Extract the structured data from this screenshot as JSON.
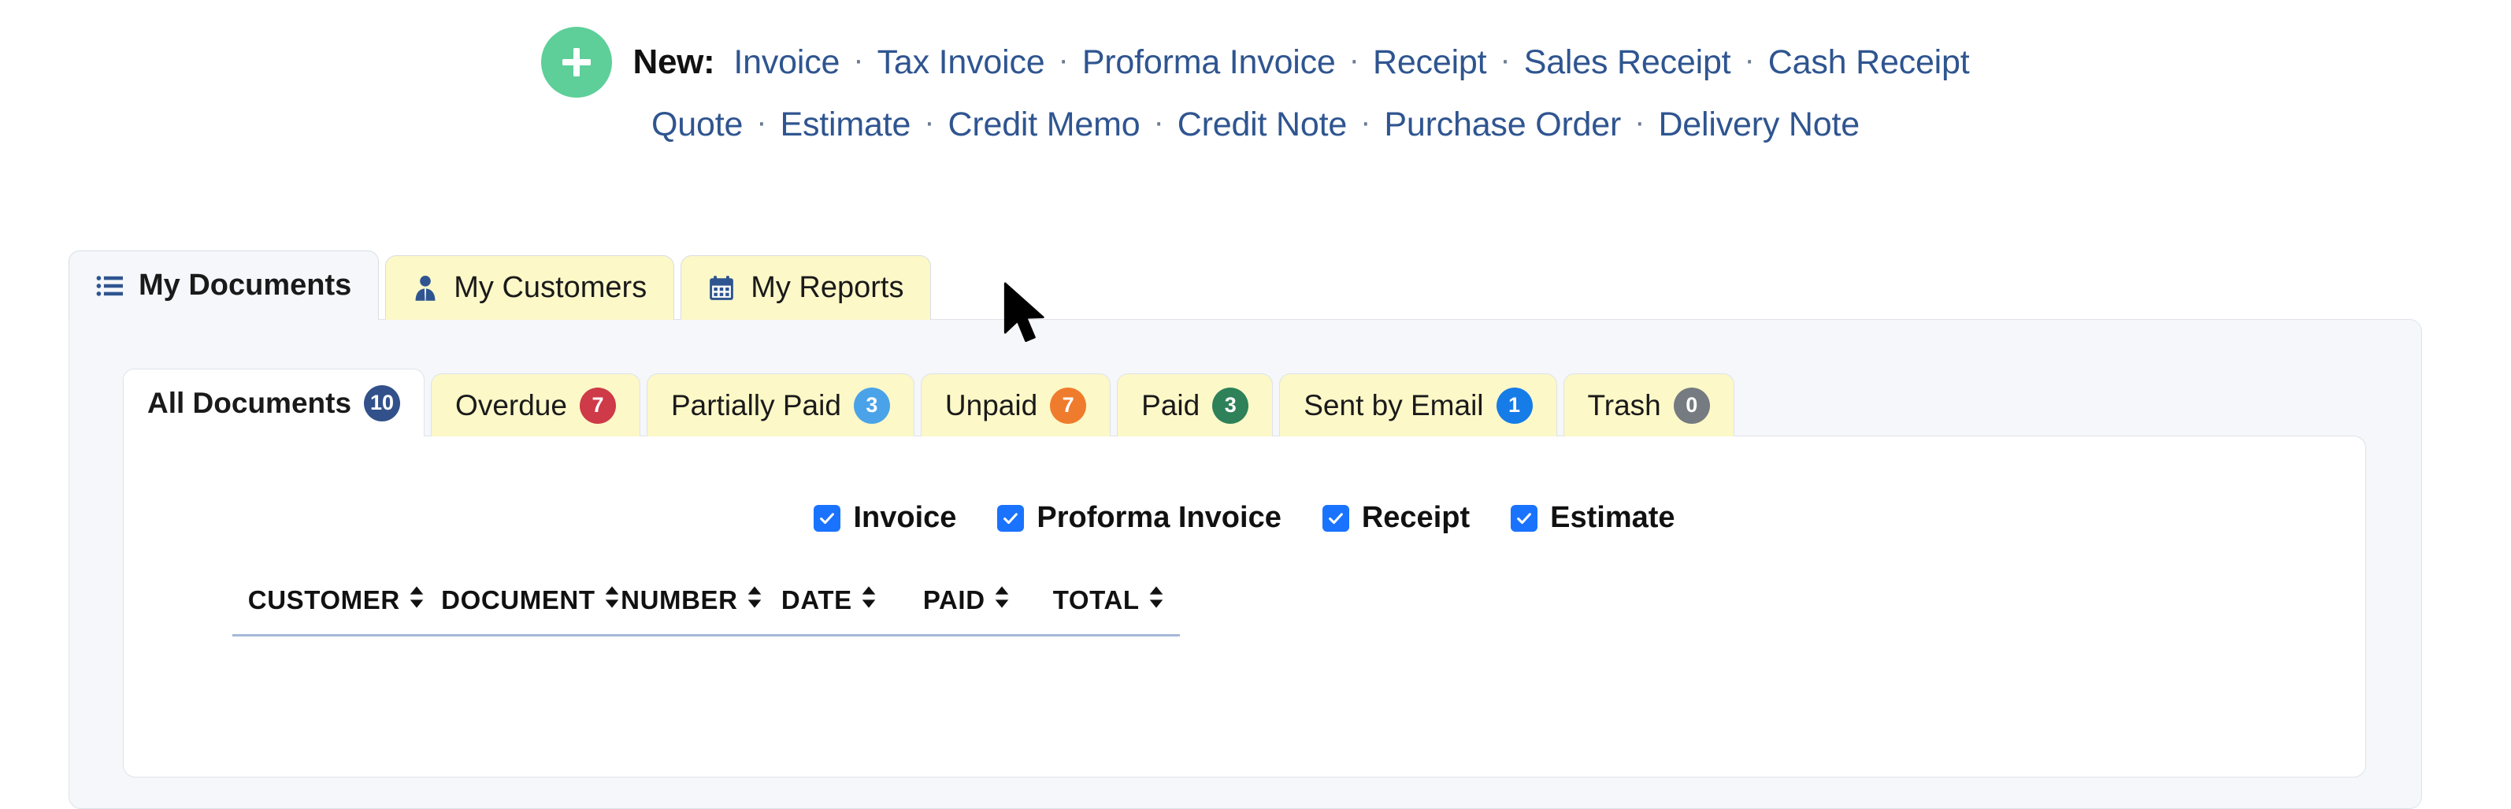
{
  "new_bar": {
    "plus_icon": "plus-icon",
    "label": "New:",
    "row1": [
      {
        "label": "Invoice"
      },
      {
        "label": "Tax Invoice"
      },
      {
        "label": "Proforma Invoice"
      },
      {
        "label": "Receipt"
      },
      {
        "label": "Sales Receipt"
      },
      {
        "label": "Cash Receipt"
      }
    ],
    "row2": [
      {
        "label": "Quote"
      },
      {
        "label": "Estimate"
      },
      {
        "label": "Credit Memo"
      },
      {
        "label": "Credit Note"
      },
      {
        "label": "Purchase Order"
      },
      {
        "label": "Delivery Note"
      }
    ],
    "separator": "·"
  },
  "main_tabs": [
    {
      "label": "My Documents",
      "icon": "list-icon",
      "active": true
    },
    {
      "label": "My Customers",
      "icon": "person-icon",
      "active": false
    },
    {
      "label": "My Reports",
      "icon": "calendar-icon",
      "active": false
    }
  ],
  "filter_tabs": [
    {
      "label": "All Documents",
      "count": "10",
      "color": "#32518a",
      "active": true
    },
    {
      "label": "Overdue",
      "count": "7",
      "color": "#ce3a47",
      "active": false
    },
    {
      "label": "Partially Paid",
      "count": "3",
      "color": "#4aa3e8",
      "active": false
    },
    {
      "label": "Unpaid",
      "count": "7",
      "color": "#ef7c2c",
      "active": false
    },
    {
      "label": "Paid",
      "count": "3",
      "color": "#2e8159",
      "active": false
    },
    {
      "label": "Sent by Email",
      "count": "1",
      "color": "#167ce8",
      "active": false
    },
    {
      "label": "Trash",
      "count": "0",
      "color": "#757b80",
      "active": false
    }
  ],
  "doc_type_filters": [
    {
      "label": "Invoice",
      "checked": true
    },
    {
      "label": "Proforma Invoice",
      "checked": true
    },
    {
      "label": "Receipt",
      "checked": true
    },
    {
      "label": "Estimate",
      "checked": true
    }
  ],
  "table": {
    "columns": [
      {
        "label": "CUSTOMER",
        "sortable": true
      },
      {
        "label": "DOCUMENT",
        "sortable": true
      },
      {
        "label": "NUMBER",
        "sortable": true
      },
      {
        "label": "DATE",
        "sortable": true
      },
      {
        "label": "PAID",
        "sortable": true
      },
      {
        "label": "TOTAL",
        "sortable": true
      }
    ],
    "rows": []
  },
  "colors": {
    "link": "#2f5590",
    "plus_button": "#5ecf99",
    "tab_inactive": "#fcf8c8",
    "tab_active": "#f5f7fa",
    "panel_bg": "#f5f7fa",
    "checkbox": "#1a73ff",
    "table_rule": "#a5b8d8"
  }
}
